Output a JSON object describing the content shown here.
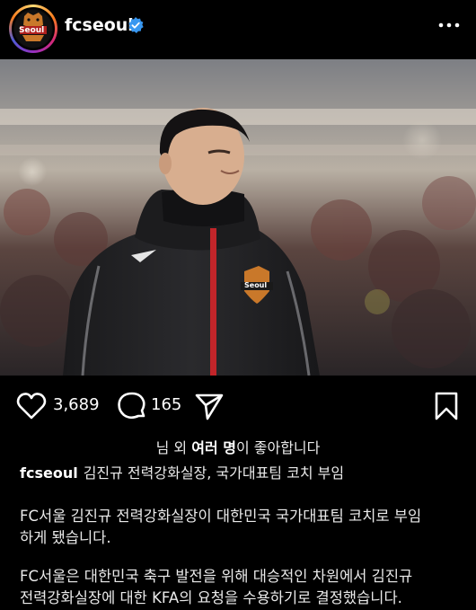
{
  "header": {
    "avatar_text": "Seoul",
    "username": "fcseoul",
    "verified_icon": "verified-badge-icon",
    "more_icon": "more-options-icon"
  },
  "photo": {
    "description_icon": "post-photo",
    "jacket_badge": "Seoul"
  },
  "actions": {
    "like_count": "3,689",
    "comment_count": "165",
    "icons": [
      "heart-icon",
      "comment-icon",
      "share-icon",
      "bookmark-icon"
    ]
  },
  "likes": {
    "prefix": "님 외 ",
    "bold": "여러 명",
    "suffix": "이 좋아합니다"
  },
  "caption": {
    "username": "fcseoul",
    "headline": "김진규 전력강화실장, 국가대표팀 코치 부임",
    "paragraph1_line1": "FC서울 김진규 전력강화실장이 대한민국 국가대표팀 코치로 부임",
    "paragraph1_line2": "하게 됐습니다.",
    "paragraph2_line1": "FC서울은 대한민국 축구 발전을 위해 대승적인 차원에서 김진규",
    "paragraph2_line2": "전력강화실장에 대한 KFA의 요청을 수용하기로 결정했습니다."
  },
  "colors": {
    "background": "#000000",
    "verified": "#3897f0",
    "text": "#f5f5f5"
  }
}
